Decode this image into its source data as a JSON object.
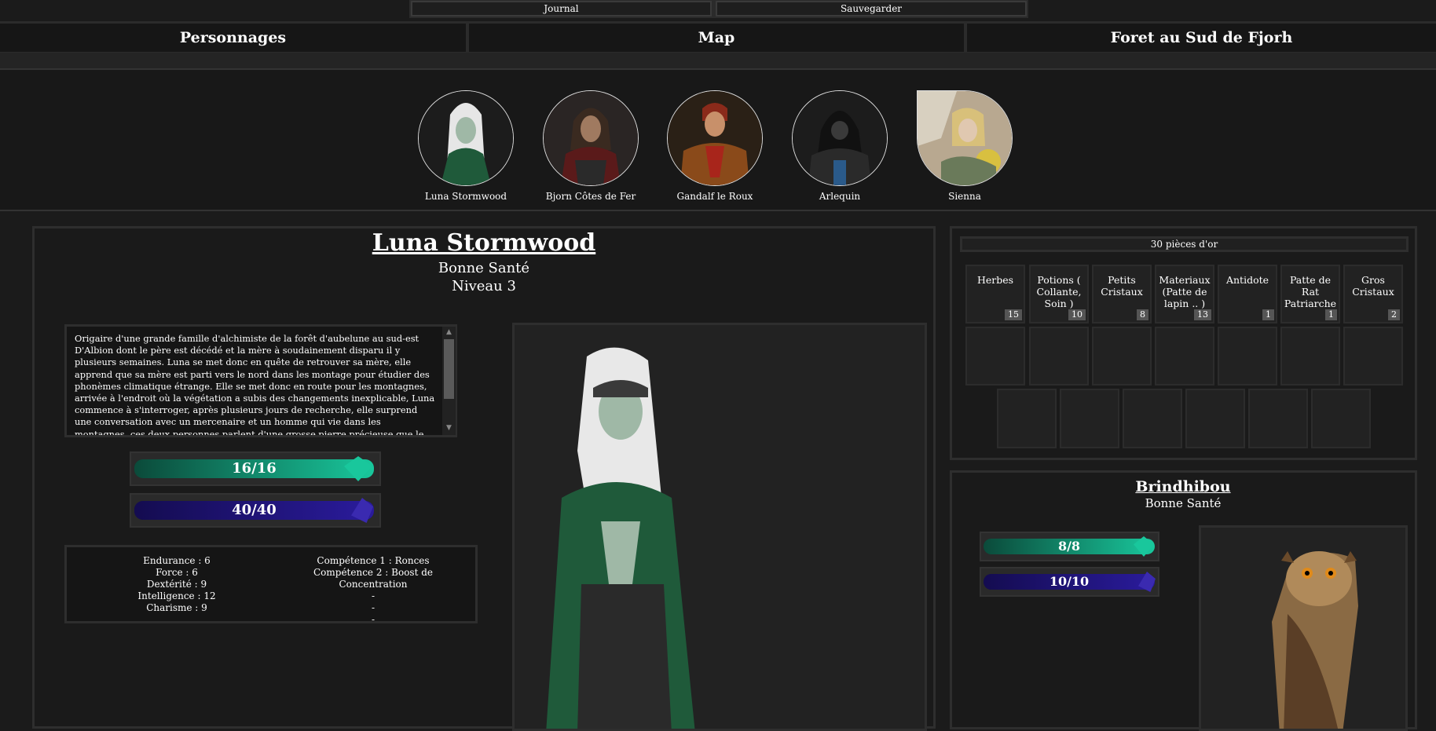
{
  "topbar": {
    "journal_label": "Journal",
    "save_label": "Sauvegarder"
  },
  "nav": {
    "characters_label": "Personnages",
    "map_label": "Map",
    "location_label": "Foret au Sud de Fjorh"
  },
  "party": [
    {
      "name": "Luna Stormwood"
    },
    {
      "name": "Bjorn Côtes de Fer"
    },
    {
      "name": "Gandalf le Roux"
    },
    {
      "name": "Arlequin"
    },
    {
      "name": "Sienna"
    }
  ],
  "character": {
    "name": "Luna Stormwood",
    "health_status": "Bonne Santé",
    "level": "Niveau 3",
    "description": "Origaire d'une grande famille d'alchimiste de la forêt d'aubelune au sud-est D'Albion dont le père est décédé et la mère à soudainement disparu il y plusieurs semaines. Luna se met donc en quête de retrouver sa mère, elle apprend que sa mère est parti vers le nord dans les montage pour étudier des phonèmes climatique étrange. Elle se met donc en route pour les montagnes, arrivée à l'endroit où la végétation a subis des changements inexplicable, Luna commence à s'interroger, après plusieurs jours de recherche, elle surprend une conversation avec un mercenaire et un homme qui vie dans les montagnes, ces deux personnes parlent d'une grosse pierre précieuse que le roi Herald recherche, après quelques instants, grâce aux recherches qu'elles a effectués ces jours précédents",
    "hp": {
      "text": "16/16",
      "current": 16,
      "max": 16
    },
    "mana": {
      "text": "40/40",
      "current": 40,
      "max": 40
    },
    "stats": [
      "Endurance : 6",
      "Force : 6",
      "Dextérité : 9",
      "Intelligence : 12",
      "Charisme : 9"
    ],
    "skills": [
      "Compétence 1 : Ronces",
      "Compétence 2 : Boost de Concentration",
      "-",
      "-",
      "-"
    ]
  },
  "inventory": {
    "gold": "30 pièces d'or",
    "items": [
      {
        "name": "Herbes",
        "qty": "15"
      },
      {
        "name": "Potions ( Collante, Soin )",
        "qty": "10"
      },
      {
        "name": "Petits Cristaux",
        "qty": "8"
      },
      {
        "name": "Materiaux (Patte de lapin .. )",
        "qty": "13"
      },
      {
        "name": "Antidote",
        "qty": "1"
      },
      {
        "name": "Patte de Rat Patriarche",
        "qty": "1"
      },
      {
        "name": "Gros Cristaux",
        "qty": "2"
      }
    ]
  },
  "companion": {
    "name": "Brindhibou",
    "health_status": "Bonne Santé",
    "hp": {
      "text": "8/8",
      "current": 8,
      "max": 8
    },
    "mana": {
      "text": "10/10",
      "current": 10,
      "max": 10
    }
  },
  "colors": {
    "hp": "#19c79c",
    "mana": "#2a1b9c",
    "background": "#1b1b1b"
  },
  "icons": [
    "green-gem-icon",
    "blue-gem-icon"
  ]
}
